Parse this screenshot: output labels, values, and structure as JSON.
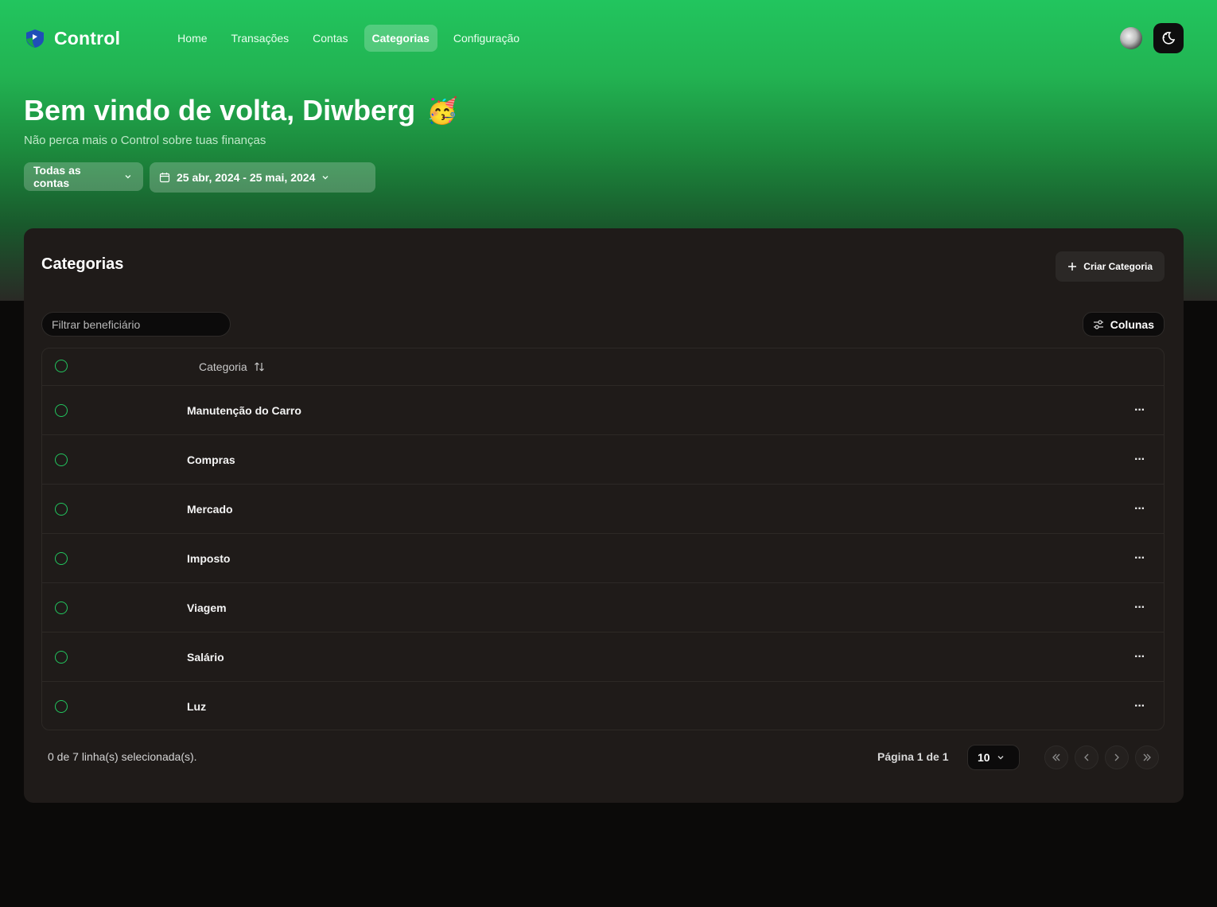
{
  "app": {
    "brand": "Control",
    "nav": [
      "Home",
      "Transações",
      "Contas",
      "Categorias",
      "Configuração"
    ],
    "active_nav": "Categorias"
  },
  "welcome": {
    "title": "Bem vindo de volta, Diwberg",
    "emoji": "🥳",
    "subtitle": "Não perca mais o Control sobre tuas finanças"
  },
  "filters": {
    "accounts_label": "Todas as contas",
    "date_range": "25 abr, 2024 - 25 mai, 2024"
  },
  "card": {
    "title": "Categorias",
    "create_label": "Criar Categoria",
    "filter_placeholder": "Filtrar beneficiário",
    "columns_label": "Colunas",
    "column_header": "Categoria",
    "rows": [
      "Manutenção do Carro",
      "Compras",
      "Mercado",
      "Imposto",
      "Viagem",
      "Salário",
      "Luz"
    ],
    "more_label": "···"
  },
  "footer": {
    "selection": "0 de 7 linha(s) selecionada(s).",
    "page_info": "Página 1 de 1",
    "page_size": "10"
  },
  "colors": {
    "accent": "#22c55e",
    "card_bg": "#1f1b19",
    "page_bg": "#0b0a09"
  }
}
